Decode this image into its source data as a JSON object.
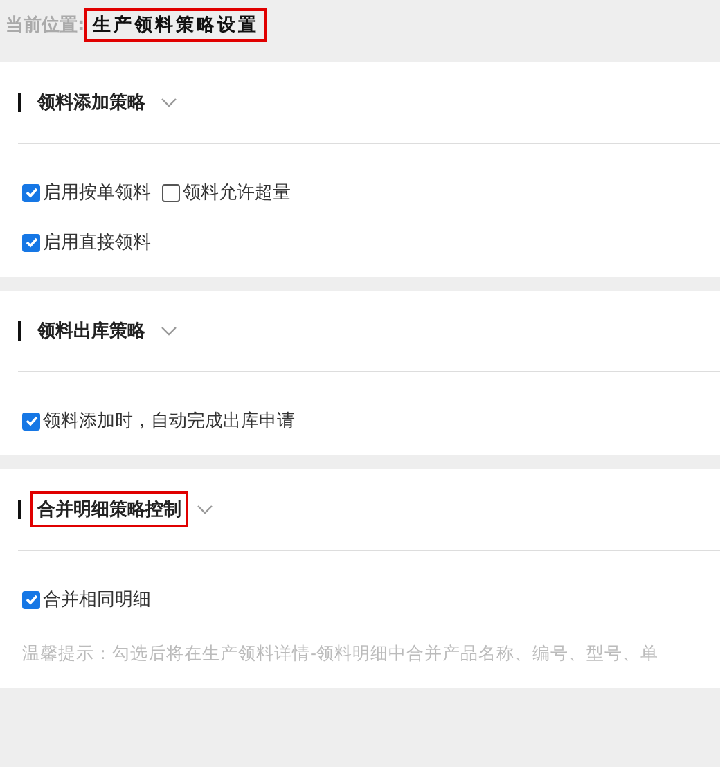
{
  "breadcrumb": {
    "label": "当前位置:",
    "current": "生产领料策略设置",
    "highlighted": true
  },
  "sections": [
    {
      "title": "领料添加策略",
      "highlighted": false,
      "expanded": true,
      "rows": [
        [
          {
            "label": "启用按单领料",
            "checked": true
          },
          {
            "label": "领料允许超量",
            "checked": false
          }
        ],
        [
          {
            "label": "启用直接领料",
            "checked": true
          }
        ]
      ]
    },
    {
      "title": "领料出库策略",
      "highlighted": false,
      "expanded": true,
      "rows": [
        [
          {
            "label": "领料添加时，自动完成出库申请",
            "checked": true
          }
        ]
      ]
    },
    {
      "title": "合并明细策略控制",
      "highlighted": true,
      "expanded": true,
      "rows": [
        [
          {
            "label": "合并相同明细",
            "checked": true
          }
        ]
      ],
      "hint": "温馨提示：勾选后将在生产领料详情-领料明细中合并产品名称、编号、型号、单"
    }
  ]
}
